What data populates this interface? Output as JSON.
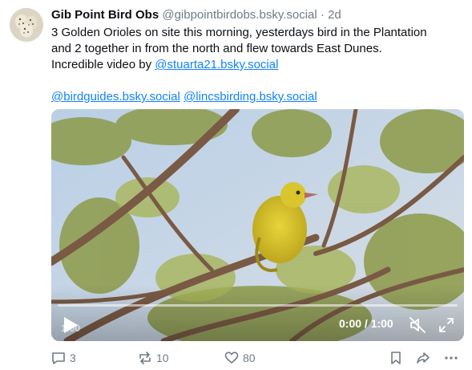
{
  "post": {
    "author_name": "Gib Point Bird Obs",
    "author_handle": "@gibpointbirdobs.bsky.social",
    "separator": "·",
    "age": "2d",
    "text_lines": [
      "3 Golden Orioles on site this morning, yesterdays bird in the Plantation",
      "and 2 together in from the north and flew towards East Dunes.",
      "Incredible video by "
    ],
    "mention_stuart": "@stuarta21.bsky.social",
    "mention_birdguides": "@birdguides.bsky.social",
    "mention_lincs": "@lincsbirding.bsky.social"
  },
  "video": {
    "current_time": "0:00 / 1:00",
    "duration_overlay": "1:00",
    "progress": 0
  },
  "actions": {
    "reply_count": "3",
    "repost_count": "10",
    "like_count": "80"
  },
  "icons": {
    "reply": "speech-bubble-icon",
    "repost": "repost-arrows-icon",
    "like": "heart-icon",
    "bookmark": "bookmark-icon",
    "share": "share-arrow-icon",
    "more": "more-dots-icon",
    "play": "play-icon",
    "mute": "speaker-muted-icon",
    "fullscreen": "fullscreen-icon"
  },
  "colors": {
    "link": "#1083fe",
    "muted": "#6f7b86",
    "text": "#0b0f14"
  }
}
